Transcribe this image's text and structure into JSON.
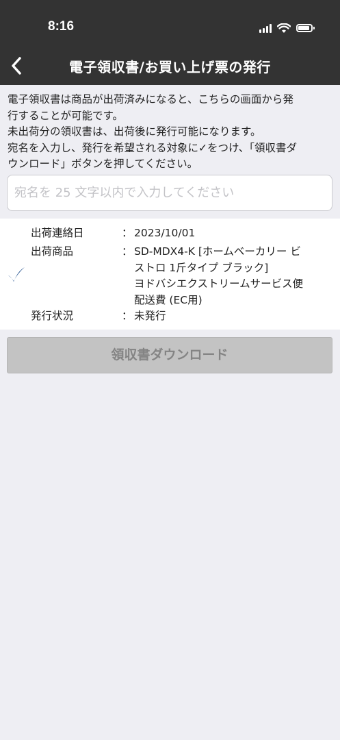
{
  "status_bar": {
    "time": "8:16"
  },
  "nav": {
    "title": "電子領収書/お買い上げ票の発行",
    "back_icon": "chevron-left-icon"
  },
  "intro": {
    "lines": [
      "電子領収書は商品が出荷済みになると、こちらの画面から発",
      "行することが可能です。",
      "未出荷分の領収書は、出荷後に発行可能になります。",
      "宛名を入力し、発行を希望される対象に✓をつけ、「領収書ダ",
      "ウンロード」ボタンを押してください。"
    ]
  },
  "recipient_field": {
    "value": "",
    "placeholder": "宛名を 25 文字以内で入力してください"
  },
  "shipment": {
    "checked": true,
    "check_color": "#1f4e8c",
    "separator": "：",
    "date_label": "出荷連絡日",
    "date_value": "2023/10/01",
    "items_label": "出荷商品",
    "items_lines": [
      "SD-MDX4-K [ホームベーカリー ビ",
      "ストロ 1斤タイプ ブラック]",
      "ヨドバシエクストリームサービス便",
      "配送費 (EC用)"
    ],
    "status_label": "発行状況",
    "status_value": "未発行"
  },
  "download_button": {
    "label": "領収書ダウンロード",
    "enabled": false
  },
  "colors": {
    "header_bg": "#333333",
    "page_bg": "#eeeef3",
    "button_disabled_bg": "#c3c3c3"
  }
}
